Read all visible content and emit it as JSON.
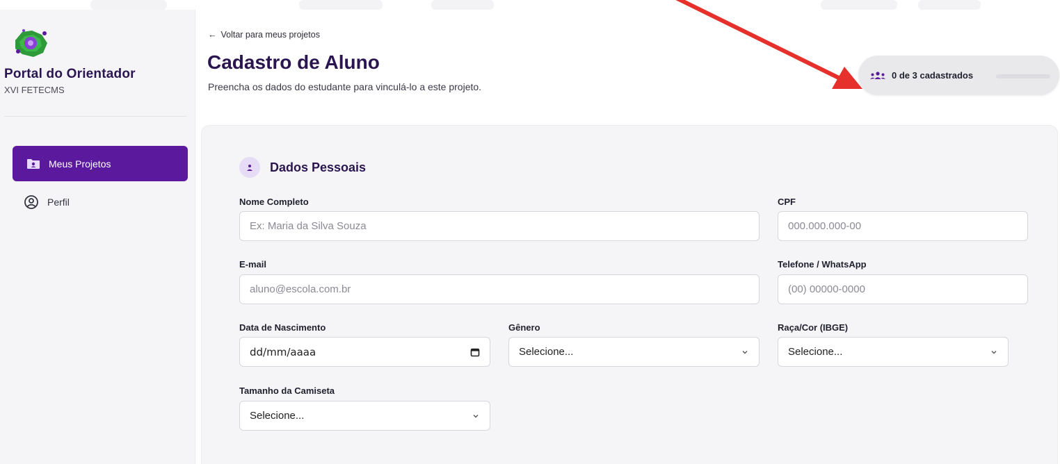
{
  "sidebar": {
    "title": "Portal do Orientador",
    "subtitle": "XVI FETECMS",
    "nav": [
      {
        "label": "Meus Projetos",
        "icon": "folder-user-icon",
        "active": true
      },
      {
        "label": "Perfil",
        "icon": "user-circle-icon",
        "active": false
      }
    ]
  },
  "header": {
    "back_label": "Voltar para meus projetos",
    "title": "Cadastro de Aluno",
    "subtitle": "Preencha os dados do estudante para vinculá-lo a este projeto."
  },
  "counter": {
    "text": "0 de 3 cadastrados",
    "registered": 0,
    "max": 3
  },
  "form": {
    "section_title": "Dados Pessoais",
    "fields": {
      "nome": {
        "label": "Nome Completo",
        "placeholder": "Ex: Maria da Silva Souza"
      },
      "cpf": {
        "label": "CPF",
        "placeholder": "000.000.000-00"
      },
      "email": {
        "label": "E-mail",
        "placeholder": "aluno@escola.com.br"
      },
      "telefone": {
        "label": "Telefone / WhatsApp",
        "placeholder": "(00) 00000-0000"
      },
      "nascimento": {
        "label": "Data de Nascimento",
        "placeholder": "dd/mm/aaaa"
      },
      "genero": {
        "label": "Gênero",
        "value": "Selecione..."
      },
      "raca": {
        "label": "Raça/Cor (IBGE)",
        "value": "Selecione..."
      },
      "camiseta": {
        "label": "Tamanho da Camiseta",
        "value": "Selecione..."
      }
    }
  },
  "colors": {
    "brand_purple": "#5b1a9e",
    "title_purple": "#2a1550",
    "annotation_red": "#e5302b"
  }
}
